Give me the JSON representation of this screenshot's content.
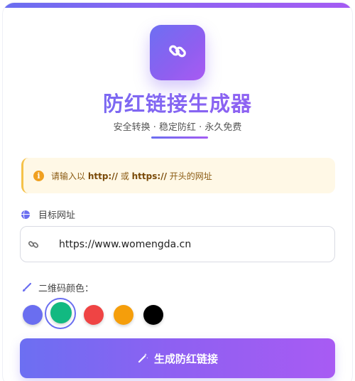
{
  "header": {
    "title": "防红链接生成器",
    "subtitle": "安全转换 · 稳定防红 · 永久免费"
  },
  "notice": {
    "text_before": "请输入以 ",
    "proto_http": "http://",
    "text_or": " 或 ",
    "proto_https": "https://",
    "text_after": " 开头的网址"
  },
  "url_field": {
    "label": "目标网址",
    "value": "https://www.womengda.cn"
  },
  "qr_color": {
    "label": "二维码颜色：",
    "options": [
      "#6a6ef0",
      "#12b981",
      "#ef4444",
      "#f59e0b",
      "#000000"
    ],
    "selected": "#12b981"
  },
  "actions": {
    "generate_label": "生成防红链接"
  },
  "colors": {
    "accent": "#7a63ee",
    "notice_bg": "#fff8e6"
  },
  "icons": {
    "logo": "link-icon",
    "notice": "info-icon",
    "field": "globe-icon",
    "input": "link-icon",
    "color": "brush-icon",
    "button": "magic-wand-icon"
  }
}
